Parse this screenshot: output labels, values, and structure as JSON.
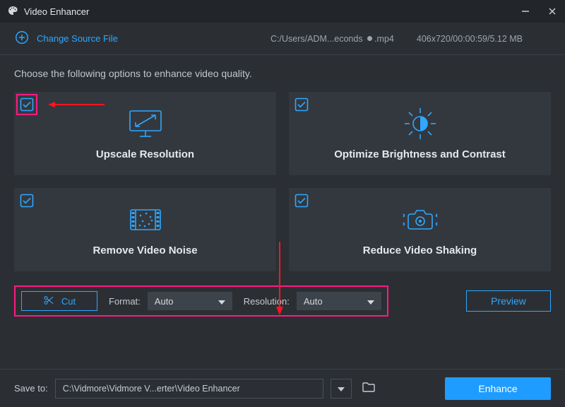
{
  "window": {
    "title": "Video Enhancer"
  },
  "source": {
    "change_label": "Change Source File",
    "path_a": "C:/Users/ADM...econds ",
    "path_b": ".mp4",
    "meta": "406x720/00:00:59/5.12 MB"
  },
  "instruction": "Choose the following options to enhance video quality.",
  "options": {
    "upscale": {
      "label": "Upscale Resolution"
    },
    "brightness": {
      "label": "Optimize Brightness and Contrast"
    },
    "noise": {
      "label": "Remove Video Noise"
    },
    "shaking": {
      "label": "Reduce Video Shaking"
    }
  },
  "controls": {
    "cut": "Cut",
    "format_label": "Format:",
    "format_value": "Auto",
    "resolution_label": "Resolution:",
    "resolution_value": "Auto",
    "preview": "Preview"
  },
  "footer": {
    "save_label": "Save to:",
    "save_path": "C:\\Vidmore\\Vidmore V...erter\\Video Enhancer",
    "enhance": "Enhance"
  }
}
